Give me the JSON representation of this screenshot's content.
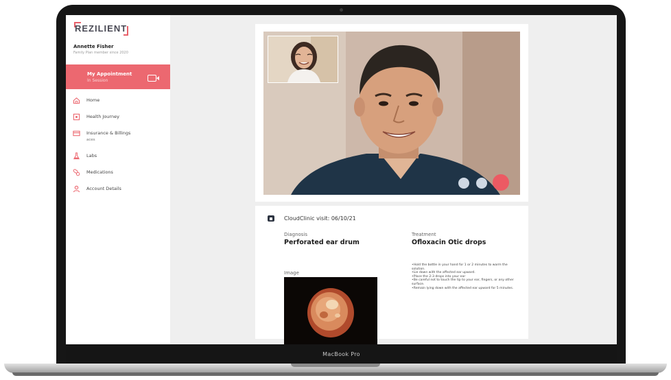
{
  "device": {
    "label": "MacBook Pro"
  },
  "sidebar": {
    "logo": "REZILIENT",
    "user": {
      "name": "Annette Fisher",
      "subtitle": "Family Plan member since 2020"
    },
    "appointment": {
      "title": "My Appointment",
      "status": "In Session",
      "icon": "video-camera-icon"
    },
    "nav": [
      {
        "label": "Home",
        "icon": "home-icon"
      },
      {
        "label": "Health Journey",
        "icon": "journal-icon"
      },
      {
        "label": "Insurance & Billings",
        "sublabel": "aces",
        "icon": "credit-card-icon"
      },
      {
        "label": "Labs",
        "icon": "flask-icon"
      },
      {
        "label": "Medications",
        "icon": "pills-icon"
      },
      {
        "label": "Account Details",
        "icon": "user-icon"
      }
    ]
  },
  "video_call": {
    "controls": [
      {
        "name": "camera-toggle",
        "color": "#cfd8e3"
      },
      {
        "name": "mic-toggle",
        "color": "#cfd8e3"
      },
      {
        "name": "end-call",
        "color": "#ec5a63"
      }
    ]
  },
  "visit": {
    "title": "CloudClinic visit: 06/10/21",
    "diagnosis": {
      "label": "Diagnosis",
      "value": "Perforated ear drum"
    },
    "image_label": "Image",
    "treatment": {
      "label": "Treatment",
      "value": "Ofloxacin Otic drops",
      "steps": [
        "•Hold the bottle in your hand for 1 or 2 minutes to warm the solution.",
        "•Lie down with the affected ear upward.",
        "•Place the 2-3 drops into your ear",
        "•Be careful not to touch the tip to your ear, fingers, or any other surface.",
        "•Remain lying down with the affected ear upward for 5 minutes."
      ]
    }
  },
  "colors": {
    "accent": "#ec6870",
    "sidebar_bg": "#ffffff",
    "content_bg": "#efefef"
  }
}
